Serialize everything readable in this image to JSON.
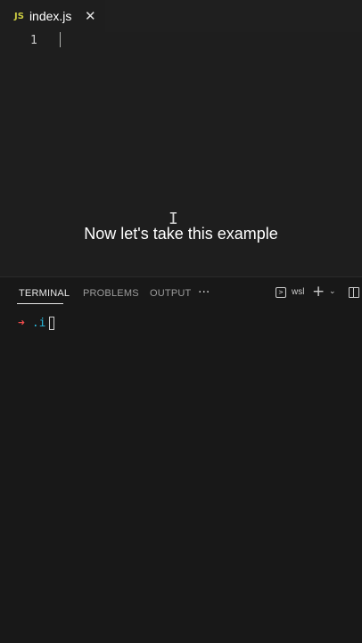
{
  "tab": {
    "icon_text": "JS",
    "label": "index.js",
    "close_glyph": "✕"
  },
  "editor": {
    "line_number": "1"
  },
  "caption": "Now let's take this example",
  "panel": {
    "tabs": [
      {
        "label": "TERMINAL",
        "active": true
      },
      {
        "label": "PROBLEMS",
        "active": false
      },
      {
        "label": "OUTPUT",
        "active": false
      }
    ],
    "more_glyph": "···",
    "terminal_name": "wsl",
    "terminal_icon_glyph": ">",
    "plus_glyph": "+",
    "chevron_glyph": "⌄"
  },
  "terminal": {
    "prompt_arrow": "➜",
    "typed_text": ".i"
  },
  "colors": {
    "editor_bg": "#1e1e1e",
    "panel_bg": "#181818",
    "js_icon": "#cbcb41",
    "prompt_arrow": "#f14c4c",
    "prompt_text": "#29b8db"
  }
}
